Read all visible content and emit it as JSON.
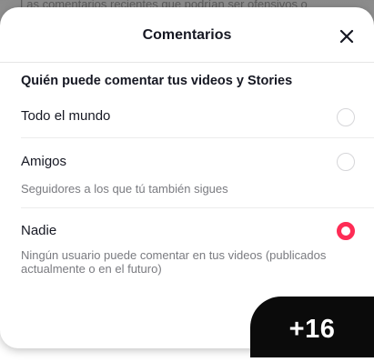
{
  "backdrop": {
    "text": "Las comentarios recientes que podrían ser ofensivos o"
  },
  "sheet": {
    "title": "Comentarios",
    "close_icon": "close-icon",
    "section_heading": "Quién puede comentar tus videos y Stories",
    "options": [
      {
        "label": "Todo el mundo",
        "description": "",
        "selected": false
      },
      {
        "label": "Amigos",
        "description": "Seguidores a los que tú también sigues",
        "selected": false
      },
      {
        "label": "Nadie",
        "description": "Ningún usuario puede comentar en tus videos (publicados actualmente o en el futuro)",
        "selected": true
      }
    ]
  },
  "badge": {
    "text": "+16"
  },
  "colors": {
    "accent": "#fe2c55",
    "text_primary": "#161823",
    "text_secondary": "#7a7b80",
    "badge_bg": "#0b0b0b"
  }
}
